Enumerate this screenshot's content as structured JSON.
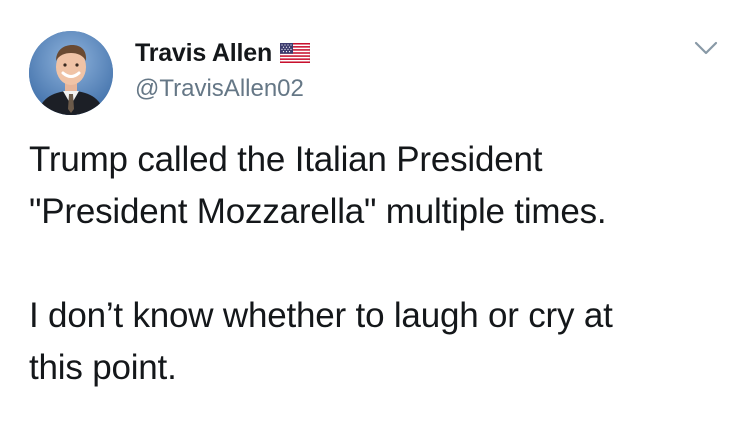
{
  "author": {
    "display_name": "Travis Allen",
    "handle": "@TravisAllen02",
    "flag_icon": "us-flag-icon",
    "avatar_icon": "profile-photo"
  },
  "tweet": {
    "paragraphs": [
      "Trump called the Italian President\n\"President Mozzarella\" multiple times.",
      "I don’t know whether to laugh or cry at\nthis point."
    ]
  },
  "menu": {
    "icon": "chevron-down-icon"
  },
  "colors": {
    "text": "#14171a",
    "secondary_text": "#657786",
    "chevron": "#8899a6",
    "background": "#ffffff"
  }
}
